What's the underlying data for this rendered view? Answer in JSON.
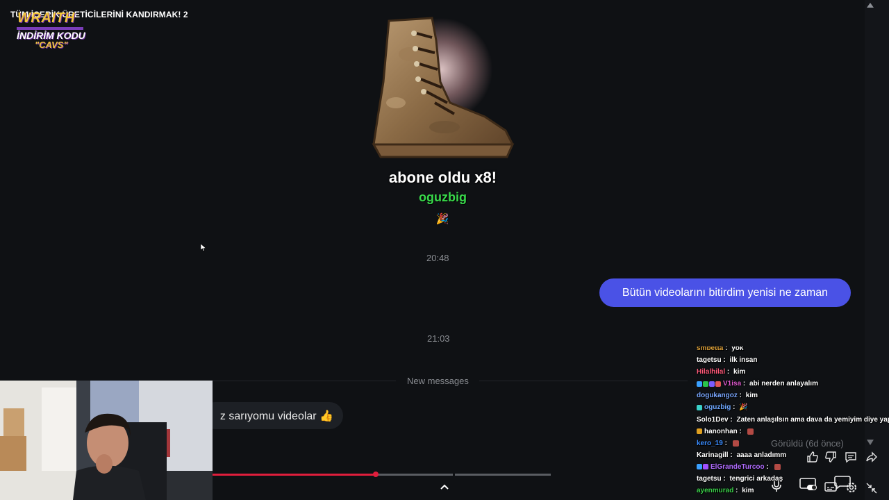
{
  "video": {
    "title": "TÜM İÇERİK ÜRETİCİLERİNİ KANDIRMAK! 2"
  },
  "sponsor": {
    "brand": "WRAITH",
    "line2": "İNDİRİM KODU",
    "line3": "\"CAVS\""
  },
  "alert": {
    "event_text": "abone oldu x8!",
    "username": "oguzbig",
    "icon": "party-popper-icon"
  },
  "conversation": {
    "timestamp_1": "20:48",
    "outgoing_message": "Bütün videolarını bitirdim yenisi ne zaman",
    "timestamp_2": "21:03",
    "new_messages_label": "New messages",
    "incoming_message": "z sarıyomu videolar 👍",
    "seen_status": "Görüldü (6d önce)"
  },
  "player": {
    "progress_fraction": 0.483,
    "colors": {
      "accent": "#e01e3c",
      "bubble": "#4a52e6",
      "username_green": "#38d84a"
    }
  },
  "actions": [
    "like-icon",
    "dislike-icon",
    "comment-icon",
    "share-icon"
  ],
  "controls": [
    "microphone-icon",
    "toggle-icon",
    "captions-icon",
    "chat-bubbles-icon",
    "settings-icon",
    "exit-fullscreen-icon"
  ],
  "chat": {
    "messages": [
      {
        "user": "smbetta",
        "color": "#e0a33a",
        "text": "yok",
        "badges": [],
        "emote": false
      },
      {
        "user": "tagetsu",
        "color": "#ffffff",
        "text": "ilk insan",
        "badges": [],
        "emote": false
      },
      {
        "user": "Hilalhilal",
        "color": "#ff5a7a",
        "text": "kim",
        "badges": [],
        "emote": false
      },
      {
        "user": "V1isa",
        "color": "#e05ad0",
        "text": "abi nerden anlayalım",
        "badges": [
          "#3aa0ff",
          "#28c44a",
          "#7a5cff",
          "#e05555"
        ],
        "emote": false
      },
      {
        "user": "dogukangoz",
        "color": "#7aa7ff",
        "text": "kim",
        "badges": [],
        "emote": false
      },
      {
        "user": "oguzbig",
        "color": "#6fa8ff",
        "text": "🎉",
        "badges": [
          "#3ad0c8"
        ],
        "emote": false
      },
      {
        "user": "Solo1Dev",
        "color": "#ffffff",
        "text": "Zaten anlaşılsın ama dava da yemiyim diye yapıyo",
        "badges": [],
        "emote": false
      },
      {
        "user": "hanonhan",
        "color": "#ffffff",
        "text": "",
        "badges": [
          "#e0a020"
        ],
        "emote": true
      },
      {
        "user": "kero_19",
        "color": "#3a8cff",
        "text": "",
        "badges": [],
        "emote": true
      },
      {
        "user": "Karinagill",
        "color": "#ffffff",
        "text": "aaaa anladımm",
        "badges": [],
        "emote": false
      },
      {
        "user": "ElGrandeTurcoo",
        "color": "#b06cff",
        "text": "",
        "badges": [
          "#3aa0ff",
          "#a050ff"
        ],
        "emote": true
      },
      {
        "user": "tagetsu",
        "color": "#ffffff",
        "text": "tengrici arkadaş",
        "badges": [],
        "emote": false
      },
      {
        "user": "ayenmurad",
        "color": "#3ad04a",
        "text": "kim",
        "badges": [],
        "emote": false
      }
    ]
  }
}
